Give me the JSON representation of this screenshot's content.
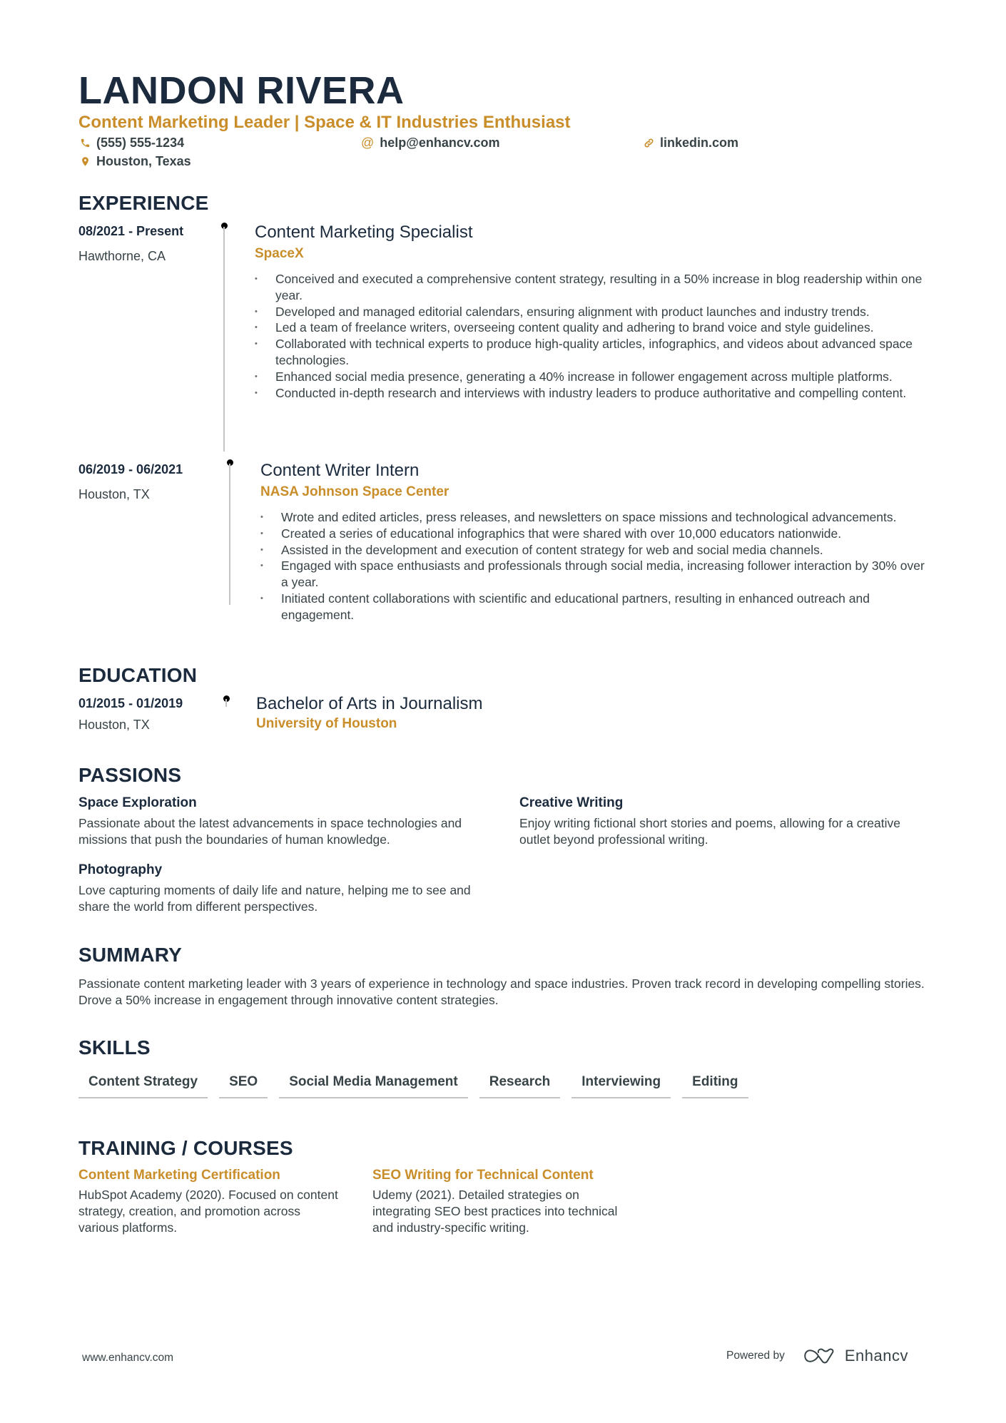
{
  "header": {
    "name": "LANDON RIVERA",
    "headline": "Content Marketing Leader | Space & IT Industries Enthusiast",
    "contacts": {
      "phone": {
        "icon": "phone-icon",
        "text": "(555) 555-1234"
      },
      "email": {
        "icon": "at-icon",
        "text": "help@enhancv.com"
      },
      "linkedin": {
        "icon": "link-icon",
        "text": "linkedin.com"
      },
      "location": {
        "icon": "map-pin-icon",
        "text": "Houston, Texas"
      }
    }
  },
  "colors": {
    "accent": "#c98d2a",
    "heading": "#1b2a3d",
    "text": "#384347",
    "timeline": "#c4c4c4"
  },
  "experience": {
    "title": "EXPERIENCE",
    "items": [
      {
        "date": "08/2021 - Present",
        "location": "Hawthorne, CA",
        "role": "Content Marketing Specialist",
        "company": "SpaceX",
        "bullets": [
          "Conceived and executed a comprehensive content strategy, resulting in a 50% increase in blog readership within one year.",
          "Developed and managed editorial calendars, ensuring alignment with product launches and industry trends.",
          "Led a team of freelance writers, overseeing content quality and adhering to brand voice and style guidelines.",
          "Collaborated with technical experts to produce high-quality articles, infographics, and videos about advanced space technologies.",
          "Enhanced social media presence, generating a 40% increase in follower engagement across multiple platforms.",
          "Conducted in-depth research and interviews with industry leaders to produce authoritative and compelling content."
        ]
      },
      {
        "date": "06/2019 - 06/2021",
        "location": "Houston, TX",
        "role": "Content Writer Intern",
        "company": "NASA Johnson Space Center",
        "bullets": [
          "Wrote and edited articles, press releases, and newsletters on space missions and technological advancements.",
          "Created a series of educational infographics that were shared with over 10,000 educators nationwide.",
          "Assisted in the development and execution of content strategy for web and social media channels.",
          "Engaged with space enthusiasts and professionals through social media, increasing follower interaction by 30% over a year.",
          "Initiated content collaborations with scientific and educational partners, resulting in enhanced outreach and engagement."
        ]
      }
    ]
  },
  "education": {
    "title": "EDUCATION",
    "items": [
      {
        "date": "01/2015 - 01/2019",
        "location": "Houston, TX",
        "degree": "Bachelor of Arts in Journalism",
        "school": "University of Houston"
      }
    ]
  },
  "passions": {
    "title": "PASSIONS",
    "items": [
      {
        "title": "Space Exploration",
        "description": "Passionate about the latest advancements in space technologies and missions that push the boundaries of human knowledge."
      },
      {
        "title": "Creative Writing",
        "description": "Enjoy writing fictional short stories and poems, allowing for a creative outlet beyond professional writing."
      },
      {
        "title": "Photography",
        "description": "Love capturing moments of daily life and nature, helping me to see and share the world from different perspectives."
      }
    ]
  },
  "summary": {
    "title": "SUMMARY",
    "text": "Passionate content marketing leader with 3 years of experience in technology and space industries. Proven track record in developing compelling stories. Drove a 50% increase in engagement through innovative content strategies."
  },
  "skills": {
    "title": "SKILLS",
    "items": [
      "Content Strategy",
      "SEO",
      "Social Media Management",
      "Research",
      "Interviewing",
      "Editing"
    ]
  },
  "training": {
    "title": "TRAINING / COURSES",
    "items": [
      {
        "title": "Content Marketing Certification",
        "description": "HubSpot Academy (2020). Focused on content strategy, creation, and promotion across various platforms."
      },
      {
        "title": "SEO Writing for Technical Content",
        "description": "Udemy (2021). Detailed strategies on integrating SEO best practices into technical and industry-specific writing."
      }
    ]
  },
  "footer": {
    "website": "www.enhancv.com",
    "powered_by": "Powered by",
    "brand": "Enhancv"
  }
}
